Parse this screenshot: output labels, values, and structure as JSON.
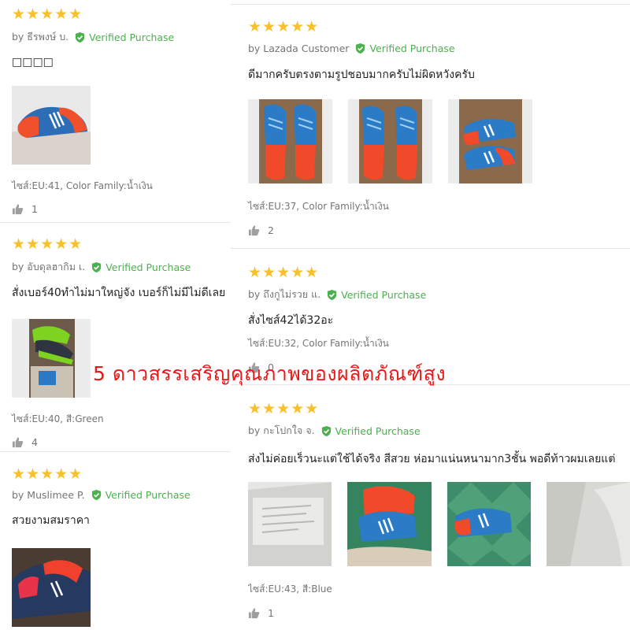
{
  "colors": {
    "star": "#f6c02f",
    "verified": "#4caf50",
    "overlay": "#e81818"
  },
  "overlay_text": "5 ดาวสรรเสริญคุณภาพของผลิตภัณฑ์สูง",
  "left_reviews": [
    {
      "stars": "★★★★★",
      "author": "by ธีรพงษ์ บ.",
      "verified": "Verified Purchase",
      "text": "□□□□",
      "sku": "ไซส์:EU:41, Color Family:น้ำเงิน",
      "likes": "1"
    },
    {
      "stars": "★★★★★",
      "author": "by อับดุลฮากิม เ.",
      "verified": "Verified Purchase",
      "text": "สั่งเบอร์40ทำไม่มาใหญ่จัง เบอร์ก็ไม่มีไม่ดีเลย",
      "sku": "ไซส์:EU:40, สี:Green",
      "likes": "4"
    },
    {
      "stars": "★★★★★",
      "author": "by Muslimee P.",
      "verified": "Verified Purchase",
      "text": "สวยงามสมราคา"
    }
  ],
  "right_reviews": [
    {
      "stars": "★★★★★",
      "author": "by Lazada Customer",
      "verified": "Verified Purchase",
      "text": "ดีมากครับตรงตามรูปชอบมากครับไม่ผิดหวังครับ",
      "sku": "ไซส์:EU:37, Color Family:น้ำเงิน",
      "likes": "2"
    },
    {
      "stars": "★★★★★",
      "author": "by ถึงกูไม่รวย แ.",
      "verified": "Verified Purchase",
      "text": "สั่งไซส์42ได้32อะ",
      "sku": "ไซส์:EU:32, Color Family:น้ำเงิน",
      "likes": "0"
    },
    {
      "stars": "★★★★★",
      "author": "by กะโปกใจ จ.",
      "verified": "Verified Purchase",
      "text": "ส่งไม่ค่อยเร็วนะแต่ใช้ได้จริง สีสวย ห่อมาแน่นหนามาก3ชั้น พอดีท้าวผมเลยแต่",
      "sku": "ไซส์:EU:43, สี:Blue",
      "likes": "1"
    }
  ]
}
